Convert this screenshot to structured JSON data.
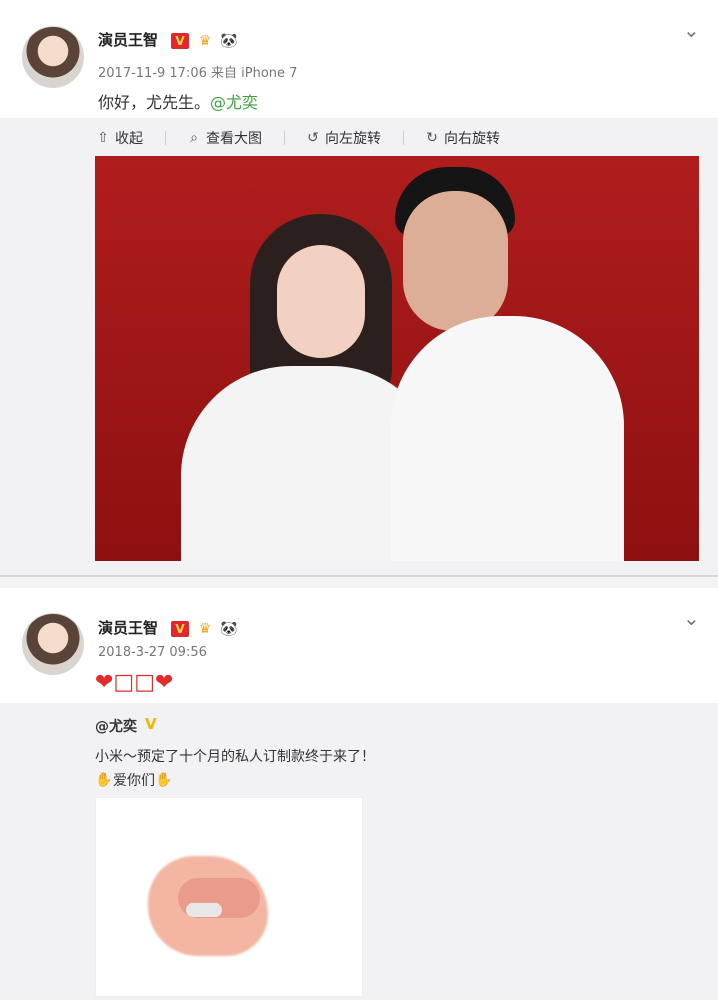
{
  "post1": {
    "author": "演员王智",
    "vip_badge": "V",
    "meta": "2017-11-9 17:06 来自 iPhone 7",
    "text": "你好，尤先生。",
    "mention": "@尤奕",
    "toolbar": {
      "collapse": "收起",
      "view_large": "查看大图",
      "rotate_left": "向左旋转",
      "rotate_right": "向右旋转"
    }
  },
  "post2": {
    "author": "演员王智",
    "vip_badge": "V",
    "meta": "2018-3-27 09:56",
    "text": "❤□□❤",
    "repost": {
      "author": "@尤奕",
      "line1": "小米～预定了十个月的私人订制款终于来了！",
      "line2": "爱你们"
    }
  },
  "icons": {
    "avatar": "avatar",
    "crown": "crown-icon",
    "panda": "panda-icon",
    "chevron": "chevron-down-icon",
    "collapse": "collapse-icon",
    "search": "search-icon",
    "rotate_left": "rotate-left-icon",
    "rotate_right": "rotate-right-icon",
    "hand": "hand-icon"
  },
  "colors": {
    "mention": "#3fa33f",
    "vip_red": "#e3272c",
    "vip_yellow": "#ffd84b",
    "photo_red": "#a51818"
  }
}
